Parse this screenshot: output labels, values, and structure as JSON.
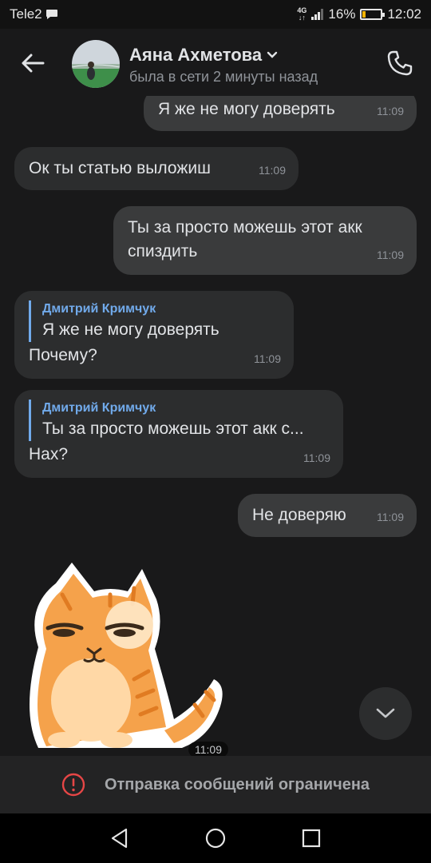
{
  "status_bar": {
    "carrier": "Tele2",
    "network": "4G",
    "battery_percent": "16%",
    "battery_level": 0.16,
    "time": "12:02"
  },
  "header": {
    "name": "Аяна Ахметова",
    "status": "была в сети 2 минуты назад",
    "back_icon": "arrow-left-icon",
    "call_icon": "phone-icon"
  },
  "messages": [
    {
      "direction": "out",
      "text": "Я же не могу доверять",
      "time": "11:09"
    },
    {
      "direction": "in",
      "text": "Ок ты статью выложиш",
      "time": "11:09"
    },
    {
      "direction": "out",
      "text_line1": "Ты за просто можешь этот акк",
      "text_line2": "спиздить",
      "time": "11:09"
    },
    {
      "direction": "in",
      "quote_author": "Дмитрий Кримчук",
      "quote_text": "Я же не могу доверять",
      "text": "Почему?",
      "time": "11:09"
    },
    {
      "direction": "in",
      "quote_author": "Дмитрий Кримчук",
      "quote_text": "Ты за просто можешь этот акк с...",
      "text": "Нах?",
      "time": "11:09"
    },
    {
      "direction": "out",
      "text": "Не доверяю",
      "time": "11:09"
    }
  ],
  "sticker": {
    "name": "cat-sticker",
    "time": "11:09"
  },
  "restriction": {
    "text": "Отправка сообщений ограничена",
    "icon": "alert-circle-icon"
  },
  "colors": {
    "background": "#19191a",
    "bubble_in": "#2c2d2e",
    "bubble_out": "#3a3b3c",
    "accent": "#71aaeb",
    "alert": "#e64646"
  }
}
